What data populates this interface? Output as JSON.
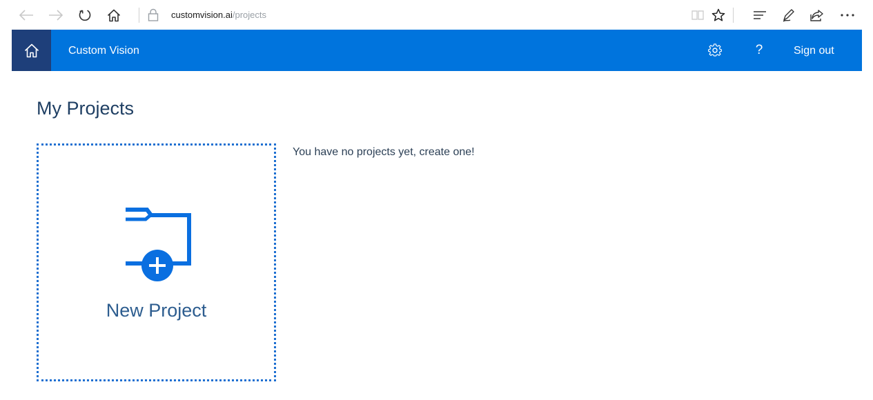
{
  "browser": {
    "url_domain": "customvision.ai",
    "url_path": "/projects",
    "icons": [
      "back-arrow-icon",
      "forward-arrow-icon",
      "refresh-icon",
      "home-icon",
      "lock-icon",
      "reading-view-icon",
      "favorite-star-icon",
      "hub-icon",
      "pen-icon",
      "share-icon",
      "more-icon"
    ]
  },
  "header": {
    "app_title": "Custom Vision",
    "sign_out_label": "Sign out",
    "help_label": "?",
    "icons": [
      "home-icon",
      "settings-gear-icon",
      "help-icon"
    ]
  },
  "main": {
    "page_title": "My Projects",
    "new_project_label": "New Project",
    "empty_message": "You have no projects yet, create one!"
  },
  "colors": {
    "accent": "#0074dd",
    "home_tile": "#1e3f7a",
    "card_border": "#1d6fd1",
    "title_text": "#1f3f63"
  }
}
